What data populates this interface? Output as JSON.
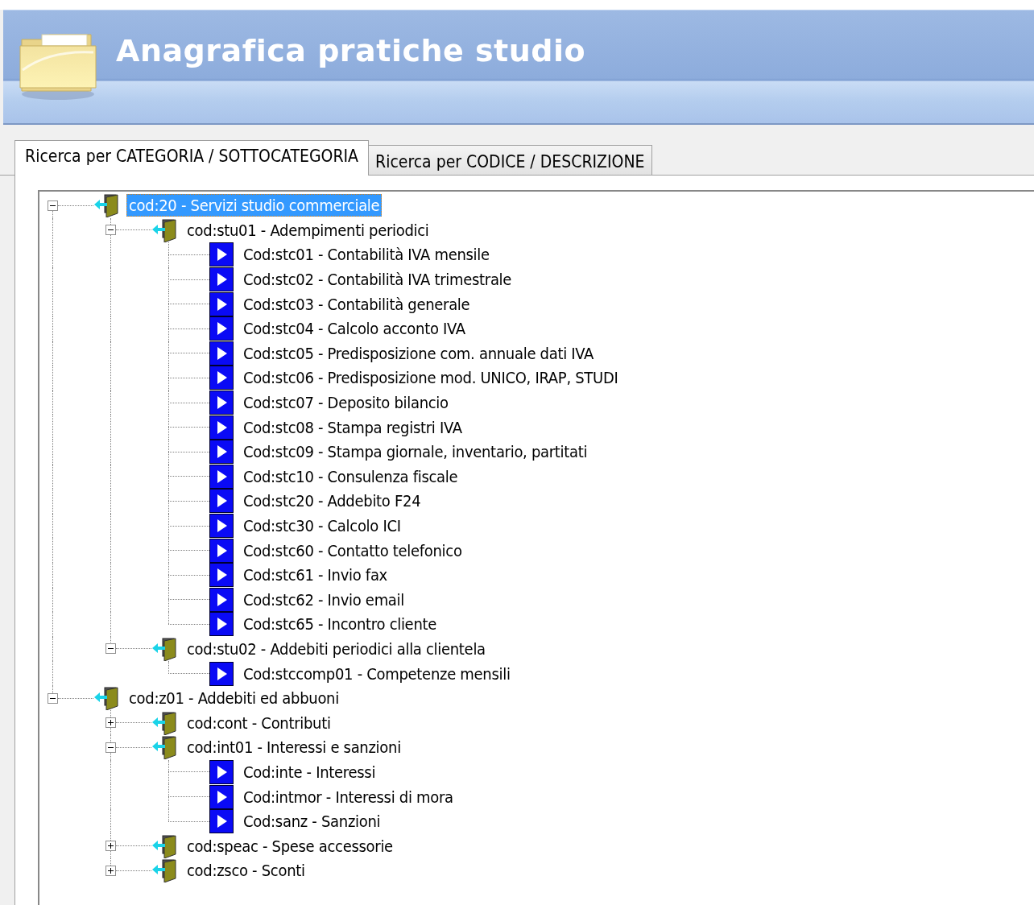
{
  "window": {
    "title": "Anagrafica pratiche studio"
  },
  "tabs": [
    {
      "label": "Ricerca per CATEGORIA / SOTTOCATEGORIA",
      "selected": true
    },
    {
      "label": "Ricerca per CODICE / DESCRIZIONE",
      "selected": false
    }
  ],
  "tree": [
    {
      "kind": "category",
      "label": "cod:20 - Servizi studio commerciale",
      "expanded": true,
      "selected": true,
      "children": [
        {
          "kind": "category",
          "label": "cod:stu01 - Adempimenti periodici",
          "expanded": true,
          "selected": false,
          "children": [
            {
              "kind": "practice",
              "label": "Cod:stc01 - Contabilità IVA mensile",
              "selected": false
            },
            {
              "kind": "practice",
              "label": "Cod:stc02 - Contabilità IVA trimestrale",
              "selected": false
            },
            {
              "kind": "practice",
              "label": "Cod:stc03 - Contabilità generale",
              "selected": false
            },
            {
              "kind": "practice",
              "label": "Cod:stc04 - Calcolo acconto IVA",
              "selected": false
            },
            {
              "kind": "practice",
              "label": "Cod:stc05 - Predisposizione com. annuale dati IVA",
              "selected": false
            },
            {
              "kind": "practice",
              "label": "Cod:stc06 - Predisposizione mod. UNICO, IRAP, STUDI",
              "selected": false
            },
            {
              "kind": "practice",
              "label": "Cod:stc07 - Deposito bilancio",
              "selected": false
            },
            {
              "kind": "practice",
              "label": "Cod:stc08 - Stampa registri IVA",
              "selected": false
            },
            {
              "kind": "practice",
              "label": "Cod:stc09 - Stampa giornale, inventario, partitati",
              "selected": false
            },
            {
              "kind": "practice",
              "label": "Cod:stc10 - Consulenza fiscale",
              "selected": false
            },
            {
              "kind": "practice",
              "label": "Cod:stc20 - Addebito F24",
              "selected": false
            },
            {
              "kind": "practice",
              "label": "Cod:stc30 - Calcolo ICI",
              "selected": false
            },
            {
              "kind": "practice",
              "label": "Cod:stc60 - Contatto telefonico",
              "selected": false
            },
            {
              "kind": "practice",
              "label": "Cod:stc61 - Invio fax",
              "selected": false
            },
            {
              "kind": "practice",
              "label": "Cod:stc62 - Invio email",
              "selected": false
            },
            {
              "kind": "practice",
              "label": "Cod:stc65 - Incontro cliente",
              "selected": false
            }
          ]
        },
        {
          "kind": "category",
          "label": "cod:stu02 - Addebiti periodici alla clientela",
          "expanded": true,
          "selected": false,
          "children": [
            {
              "kind": "practice",
              "label": "Cod:stccomp01 - Competenze mensili",
              "selected": false
            }
          ]
        }
      ]
    },
    {
      "kind": "category",
      "label": "cod:z01 - Addebiti ed abbuoni",
      "expanded": true,
      "selected": false,
      "children": [
        {
          "kind": "category",
          "label": "cod:cont - Contributi",
          "expanded": false,
          "selected": false
        },
        {
          "kind": "category",
          "label": "cod:int01 - Interessi e sanzioni",
          "expanded": true,
          "selected": false,
          "children": [
            {
              "kind": "practice",
              "label": "Cod:inte - Interessi",
              "selected": false
            },
            {
              "kind": "practice",
              "label": "Cod:intmor - Interessi di mora",
              "selected": false
            },
            {
              "kind": "practice",
              "label": "Cod:sanz - Sanzioni",
              "selected": false
            }
          ]
        },
        {
          "kind": "category",
          "label": "cod:speac - Spese accessorie",
          "expanded": false,
          "selected": false
        },
        {
          "kind": "category",
          "label": "cod:zsco - Sconti",
          "expanded": false,
          "selected": false
        }
      ]
    }
  ]
}
